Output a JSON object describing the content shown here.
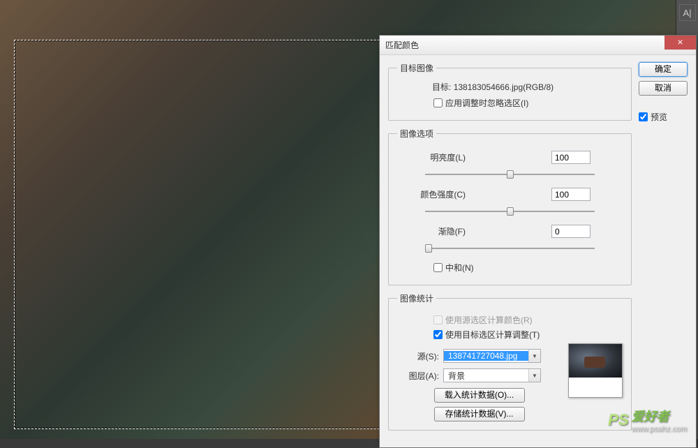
{
  "panel": {
    "icon_label": "A|"
  },
  "dialog": {
    "title": "匹配颜色",
    "close_glyph": "×",
    "target_group": {
      "legend": "目标图像",
      "target_label": "目标:",
      "target_value": "138183054666.jpg(RGB/8)",
      "ignore_selection_label": "应用调整时忽略选区(I)",
      "ignore_selection_checked": false
    },
    "options_group": {
      "legend": "图像选项",
      "luminance_label": "明亮度(L)",
      "luminance_value": "100",
      "color_intensity_label": "颜色强度(C)",
      "color_intensity_value": "100",
      "fade_label": "渐隐(F)",
      "fade_value": "0",
      "neutralize_label": "中和(N)",
      "neutralize_checked": false
    },
    "stats_group": {
      "legend": "图像统计",
      "use_source_label": "使用源选区计算颜色(R)",
      "use_source_checked": false,
      "use_source_disabled": true,
      "use_target_label": "使用目标选区计算调整(T)",
      "use_target_checked": true,
      "source_label": "源(S):",
      "source_value": "138741727048.jpg",
      "layer_label": "图层(A):",
      "layer_value": "背景",
      "load_stats_label": "载入统计数据(O)...",
      "save_stats_label": "存储统计数据(V)..."
    },
    "side": {
      "ok": "确定",
      "cancel": "取消",
      "preview_label": "预览",
      "preview_checked": true
    }
  },
  "watermark": {
    "brand": "PS",
    "text": "爱好者",
    "url": "www.psahz.com"
  }
}
